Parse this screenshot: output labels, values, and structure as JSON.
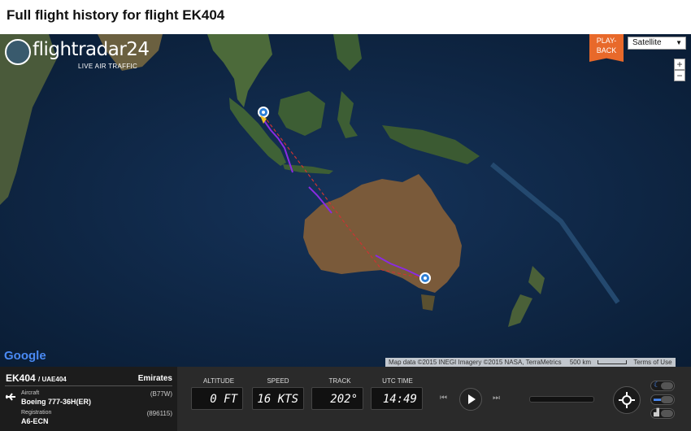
{
  "page": {
    "title": "Full flight history for flight EK404"
  },
  "map": {
    "logo_text": "flightradar24",
    "logo_subtitle": "LIVE AIR TRAFFIC",
    "playback_label": "PLAY-BACK",
    "map_type_selected": "Satellite",
    "zoom_in": "+",
    "zoom_out": "−",
    "google_logo": "Google",
    "attribution": "Map data ©2015 INEGI Imagery ©2015 NASA, TerraMetrics",
    "scale": "500 km",
    "terms": "Terms of Use",
    "route_color": "#8a2be2",
    "planned_route_color": "#cc3333"
  },
  "flight": {
    "callsign": "EK404",
    "callsign_alt": "/ UAE404",
    "airline": "Emirates",
    "aircraft_label": "Aircraft",
    "aircraft_value": "Boeing 777-36H(ER)",
    "aircraft_code": "(B77W)",
    "registration_label": "Registration",
    "registration_value": "A6-ECN",
    "registration_code": "(896115)"
  },
  "readouts": {
    "altitude_label": "ALTITUDE",
    "altitude_value": "0 FT",
    "speed_label": "SPEED",
    "speed_value": "16 KTS",
    "track_label": "TRACK",
    "track_value": "202°",
    "utc_label": "UTC TIME",
    "utc_value": "14:49"
  },
  "icons": [
    "plane-icon",
    "rewind-icon",
    "play-icon",
    "fast-forward-icon",
    "locate-icon",
    "moon-icon",
    "bars-icon",
    "chart-icon"
  ]
}
